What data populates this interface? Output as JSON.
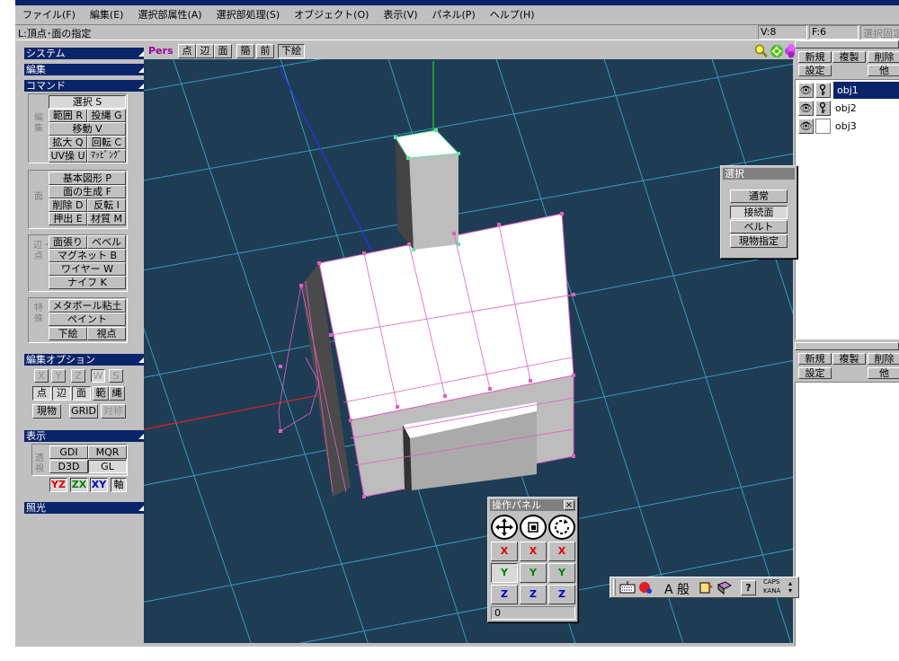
{
  "menu": [
    "ファイル(F)",
    "編集(E)",
    "選択部属性(A)",
    "選択部処理(S)",
    "オブジェクト(O)",
    "表示(V)",
    "パネル(P)",
    "ヘルプ(H)"
  ],
  "status": {
    "hint": "L:頂点･面の指定",
    "vertices": "V:8",
    "faces": "F:6",
    "select_fixed": "選択固定"
  },
  "sidebar": {
    "system": "システム",
    "edit": "編集",
    "command": "コマンド",
    "cmd_group1_label": "編集",
    "cmd_group2_label": "面",
    "cmd_group3_label": "辺・点",
    "cmd_group4_label": "特殊",
    "select": "選択 S",
    "range": "範囲 R",
    "lasso": "投縄 G",
    "move": "移動 V",
    "scale": "拡大 Q",
    "rotate": "回転 C",
    "uv": "UV操 U",
    "mapping": "ﾏｯﾋﾟﾝｸﾞ",
    "basic_shape": "基本図形 P",
    "face_gen": "面の生成 F",
    "delete": "削除 D",
    "flip": "反転 I",
    "extrude": "押出 E",
    "material": "材質 M",
    "face_stretch": "面張り",
    "bevel": "ベベル",
    "magnet": "マグネット B",
    "wire": "ワイヤー W",
    "knife": "ナイフ K",
    "metaball": "メタボール粘土",
    "paint": "ペイント",
    "underlay": "下絵",
    "viewpoint": "視点",
    "edit_options": "編集オプション",
    "opt_x": "X",
    "opt_y": "Y",
    "opt_z": "Z",
    "opt_w": "W",
    "opt_s": "S",
    "opt_point": "点",
    "opt_edge": "辺",
    "opt_face": "面",
    "opt_range": "範",
    "opt_lasso": "縄",
    "opt_real": "現物",
    "opt_grid": "GRID",
    "opt_sym": "対称",
    "display": "表示",
    "gdi": "GDI",
    "mqr": "MQR",
    "d3d": "D3D",
    "gl": "GL",
    "transparency": "透視",
    "yz": "YZ",
    "zx": "ZX",
    "xy": "XY",
    "axis": "軸",
    "lighting": "照光"
  },
  "viewport": {
    "mode": "Pers",
    "tb_point": "点",
    "tb_edge": "辺",
    "tb_face": "面",
    "tb_simple": "簡",
    "tb_front": "前",
    "tb_underlay": "下絵"
  },
  "objects_panel": {
    "new": "新規",
    "copy": "複製",
    "delete": "削除",
    "settings": "設定",
    "other": "他",
    "items": [
      {
        "name": "obj1",
        "selected": true
      },
      {
        "name": "obj2",
        "selected": false
      },
      {
        "name": "obj3",
        "selected": false
      }
    ]
  },
  "materials_panel": {
    "new": "新規",
    "copy": "複製",
    "delete": "削除",
    "settings": "設定",
    "other": "他"
  },
  "select_panel": {
    "title": "選択",
    "normal": "通常",
    "connected": "接続面",
    "belt": "ベルト",
    "real": "現物指定"
  },
  "op_panel": {
    "title": "操作パネル",
    "close": "×",
    "x": "X",
    "y": "Y",
    "z": "Z",
    "value": "0"
  },
  "ime": {
    "mode": "A 般",
    "caps": "CAPS",
    "kana": "KANA"
  },
  "colors": {
    "title": "#0a246a",
    "viewport": "#1e3d55",
    "grid": "#3fa8c8",
    "edge": "#e060c0",
    "face": "#ffffff"
  }
}
